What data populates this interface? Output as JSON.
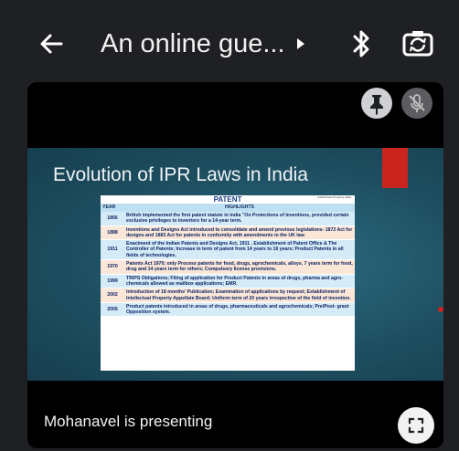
{
  "header": {
    "title": "An online gue...",
    "back_icon": "back-arrow-icon",
    "caret_icon": "caret-right-icon",
    "bluetooth_icon": "bluetooth-icon",
    "switch_camera_icon": "switch-camera-icon"
  },
  "tile": {
    "pin_icon": "pin-icon",
    "mic_off_icon": "mic-off-icon",
    "presenting_label": "Mohanavel is presenting",
    "fullscreen_icon": "fullscreen-icon"
  },
  "slide": {
    "title": "Evolution of IPR Laws in India",
    "table_title": "PATENT",
    "table_corner_note": "Intellectual Property India",
    "col_year": "YEAR",
    "col_highlights": "HIGHLIGHTS",
    "rows": [
      {
        "year": "1856",
        "text": "British implemented the first patent statute in India \"On Protections of Inventions, provided certain exclusive privileges to inventors for a 14-year term."
      },
      {
        "year": "1888",
        "text": "Inventions and Designs Act introduced to consolidate and amend previous legislations- 1872 Act for designs and 1883 Act for patents in conformity with amendments in the UK law."
      },
      {
        "year": "1911",
        "text": "Enactment of the Indian Patents and Designs Act, 1911 . Establishment of Patent Office & The Controller of Patents; Increase in term of patent from 14 years to 16 years; Product Patents in all fields of technologies."
      },
      {
        "year": "1970",
        "text": "Patents Act 1970; only Process patents for food, drugs, agrochemicals, alloys. 7 years term for food, drug and 14 years term for others; Compulsory license provisions."
      },
      {
        "year": "1999",
        "text": "TRIPS Obligations; Filing of application for Product Patents in areas of drugs, pharma and agro-chemicals allowed as mailbox applications; EMR."
      },
      {
        "year": "2002",
        "text": "Introduction of 18 months' Publication; Examination of applications by request; Establishment of Intellectual Property Appellate Board; Uniform term of 20 years irrespective of the field of invention."
      },
      {
        "year": "2005",
        "text": "Product patents introduced in areas of drugs, pharmaceuticals and agrochemicals; Pre/Post- grant Opposition system."
      }
    ]
  },
  "colors": {
    "app_bg": "#1f2023",
    "slide_bg": "#1e5062",
    "accent_red": "#c9241e",
    "row_blue": "#d5ebf7",
    "row_peach": "#fbe7d7"
  }
}
